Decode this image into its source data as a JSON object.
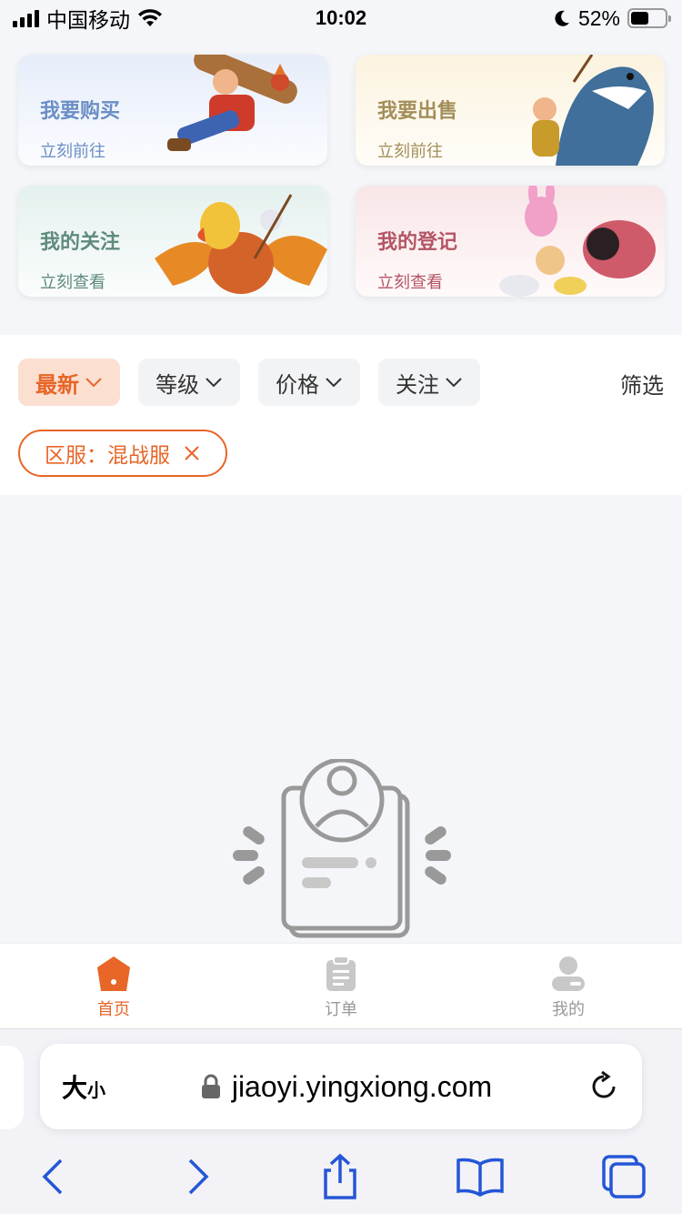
{
  "status_bar": {
    "carrier": "中国移动",
    "time": "10:02",
    "battery_percent": "52%",
    "battery_level": 0.52,
    "icons": [
      "signal-icon",
      "wifi-icon",
      "moon-icon",
      "battery-icon"
    ]
  },
  "cards": [
    {
      "title": "我要购买",
      "subtitle": "立刻前往"
    },
    {
      "title": "我要出售",
      "subtitle": "立刻前往"
    },
    {
      "title": "我的关注",
      "subtitle": "立刻查看"
    },
    {
      "title": "我的登记",
      "subtitle": "立刻查看"
    }
  ],
  "filters": {
    "sort_options": [
      {
        "label": "最新",
        "active": true
      },
      {
        "label": "等级",
        "active": false
      },
      {
        "label": "价格",
        "active": false
      },
      {
        "label": "关注",
        "active": false
      }
    ],
    "filter_link": "筛选",
    "active_tag": "区服：混战服"
  },
  "tab_bar": {
    "tabs": [
      {
        "label": "首页",
        "icon": "home-icon",
        "active": true
      },
      {
        "label": "订单",
        "icon": "clipboard-icon",
        "active": false
      },
      {
        "label": "我的",
        "icon": "user-icon",
        "active": false
      }
    ]
  },
  "safari": {
    "text_size_big": "大",
    "text_size_small": "小",
    "url": "jiaoyi.yingxiong.com"
  },
  "colors": {
    "accent": "#e76628",
    "safari_blue": "#2456d6"
  }
}
